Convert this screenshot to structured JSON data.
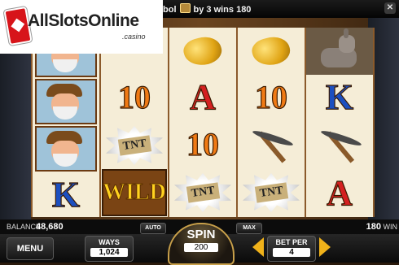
{
  "logo": {
    "brand": "AllSlotsOnline",
    "suffix": ".casino"
  },
  "top": {
    "win_prefix": "bol",
    "win_suffix": "by 3 wins 180",
    "icon": "gold-nugget-icon",
    "close_icon": "close-icon"
  },
  "reels": [
    [
      "miner",
      "miner",
      "miner",
      "K"
    ],
    [
      "10",
      "tnt",
      "wild"
    ],
    [
      "nugget",
      "A",
      "10",
      "tnt"
    ],
    [
      "nugget",
      "10",
      "pickaxe",
      "tnt"
    ],
    [
      "donkey",
      "K",
      "pickaxe",
      "A"
    ]
  ],
  "symbols": {
    "tnt_label": "TNT",
    "wild_label": "WILD",
    "ten": "10",
    "A": "A",
    "K": "K"
  },
  "status": {
    "balance_label": "BALANCE",
    "balance_value": "48,680",
    "win_value": "180",
    "win_label": "WIN"
  },
  "controls": {
    "menu": "MENU",
    "ways_label": "WAYS",
    "ways_value": "1,024",
    "auto": "AUTO",
    "spin_label": "SPIN",
    "spin_value": "200",
    "max": "MAX",
    "betper_label": "BET PER",
    "betper_value": "4"
  },
  "colors": {
    "accent": "#f0b21a",
    "reel_bg": "#f5edd7",
    "frame": "#6b4520"
  }
}
